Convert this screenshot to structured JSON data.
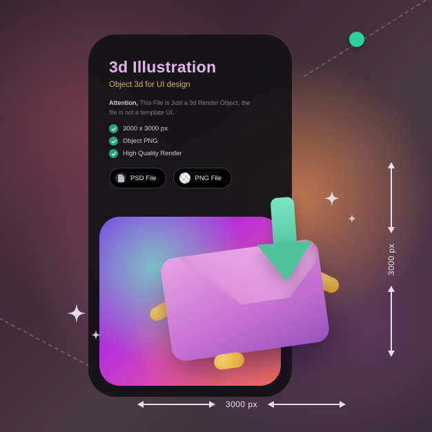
{
  "card": {
    "title": "3d Illustration",
    "subtitle": "Object 3d for UI design",
    "attention_label": "Attention,",
    "attention_text": " This File is Just a 3d Render Object, the file is not a template UI.",
    "features": [
      "3000 x 3000 px",
      "Object PNG",
      "High Quality Render"
    ],
    "chips": {
      "psd": "PSD File",
      "png": "PNG File"
    }
  },
  "dimensions": {
    "width_label": "3000 px",
    "height_label": "3000 px"
  },
  "illustration": {
    "name": "email-download-3d",
    "object": "envelope",
    "accent_icon": "arrow-down",
    "splash_color": "#d8a22a",
    "envelope_color": "#c471d0",
    "arrow_color": "#52c9a2"
  }
}
